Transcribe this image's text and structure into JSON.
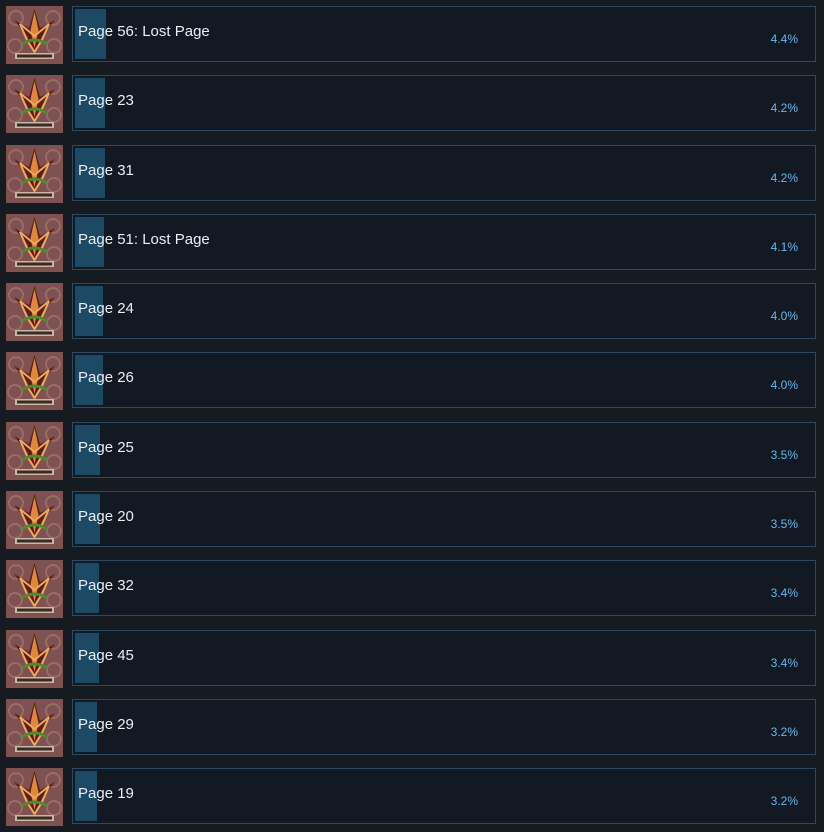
{
  "colors": {
    "background": "#161b22",
    "row_border": "#2a4a63",
    "progress_fill": "#1c4964",
    "title_text": "#e8eef3",
    "percent_text": "#62b8ef"
  },
  "achievements": [
    {
      "title": "Page 56: Lost Page",
      "percent": "4.4%",
      "progress": 0.044,
      "icon": "ornate-emblem-icon"
    },
    {
      "title": "Page 23",
      "percent": "4.2%",
      "progress": 0.042,
      "icon": "ornate-emblem-icon"
    },
    {
      "title": "Page 31",
      "percent": "4.2%",
      "progress": 0.042,
      "icon": "ornate-emblem-icon"
    },
    {
      "title": "Page 51: Lost Page",
      "percent": "4.1%",
      "progress": 0.041,
      "icon": "ornate-emblem-icon"
    },
    {
      "title": "Page 24",
      "percent": "4.0%",
      "progress": 0.04,
      "icon": "ornate-emblem-icon"
    },
    {
      "title": "Page 26",
      "percent": "4.0%",
      "progress": 0.04,
      "icon": "ornate-emblem-icon"
    },
    {
      "title": "Page 25",
      "percent": "3.5%",
      "progress": 0.035,
      "icon": "ornate-emblem-icon"
    },
    {
      "title": "Page 20",
      "percent": "3.5%",
      "progress": 0.035,
      "icon": "ornate-emblem-icon"
    },
    {
      "title": "Page 32",
      "percent": "3.4%",
      "progress": 0.034,
      "icon": "ornate-emblem-icon"
    },
    {
      "title": "Page 45",
      "percent": "3.4%",
      "progress": 0.034,
      "icon": "ornate-emblem-icon"
    },
    {
      "title": "Page 29",
      "percent": "3.2%",
      "progress": 0.032,
      "icon": "ornate-emblem-icon"
    },
    {
      "title": "Page 19",
      "percent": "3.2%",
      "progress": 0.032,
      "icon": "ornate-emblem-icon"
    }
  ]
}
